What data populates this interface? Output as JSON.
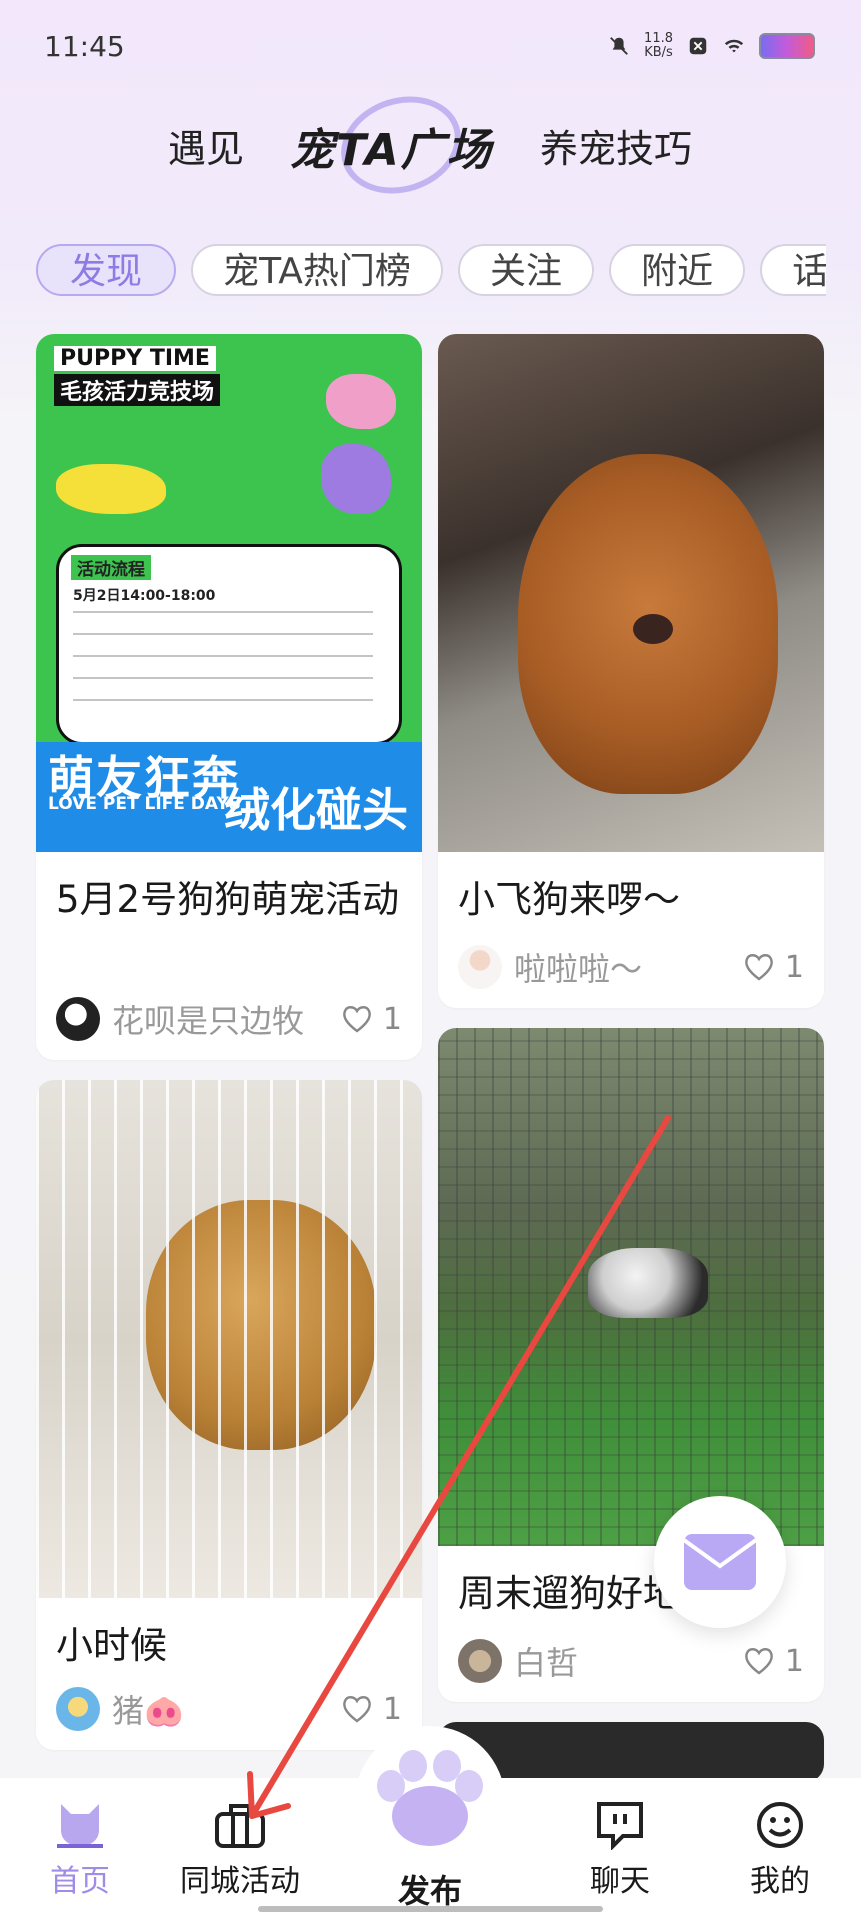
{
  "status": {
    "time": "11:45",
    "net_speed": "11.8",
    "net_unit": "KB/s"
  },
  "topnav": {
    "left": "遇见",
    "center": "宠TA广场",
    "right": "养宠技巧"
  },
  "chips": [
    "发现",
    "宠TA热门榜",
    "关注",
    "附近",
    "话"
  ],
  "cards": [
    {
      "title": "5月2号狗狗萌宠活动",
      "user": "花呗是只边牧",
      "likes": "1",
      "poster": {
        "t1": "PUPPY TIME",
        "t2": "毛孩活力竞技场",
        "big1": "萌友狂奔",
        "big2": "绒化碰头",
        "love": "LOVE PET LIFE DAYS",
        "flow": "活动流程",
        "date": "5月2日14:00-18:00"
      }
    },
    {
      "title": "小飞狗来啰～",
      "user": "啦啦啦～",
      "likes": "1"
    },
    {
      "title": "小时候",
      "user": "猪🐽",
      "likes": "1"
    },
    {
      "title": "周末遛狗好地",
      "user": "白哲",
      "likes": "1"
    }
  ],
  "tabs": {
    "home": "首页",
    "city": "同城活动",
    "publish": "发布",
    "chat": "聊天",
    "me": "我的"
  },
  "colors": {
    "accent": "#9f8be8",
    "annotation": "#e8483f"
  }
}
